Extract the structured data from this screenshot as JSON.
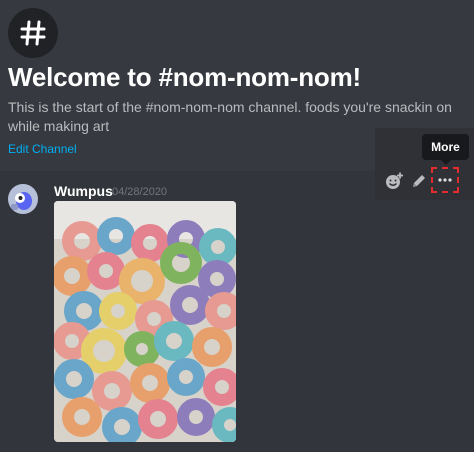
{
  "channel": {
    "welcome_title": "Welcome to #nom-nom-nom!",
    "welcome_description": "This is the start of the #nom-nom-nom channel. foods you're snackin on while making art",
    "edit_link": "Edit Channel"
  },
  "message": {
    "author": "Wumpus",
    "timestamp": "04/28/2020",
    "attachment_icon": "cereal-photo"
  },
  "toolbar": {
    "tooltip": "More",
    "icons": [
      "add-reaction-icon",
      "edit-icon",
      "more-icon"
    ]
  },
  "colors": {
    "background": "#36393f",
    "link": "#00aff4",
    "highlight_border": "#e12d2d"
  }
}
